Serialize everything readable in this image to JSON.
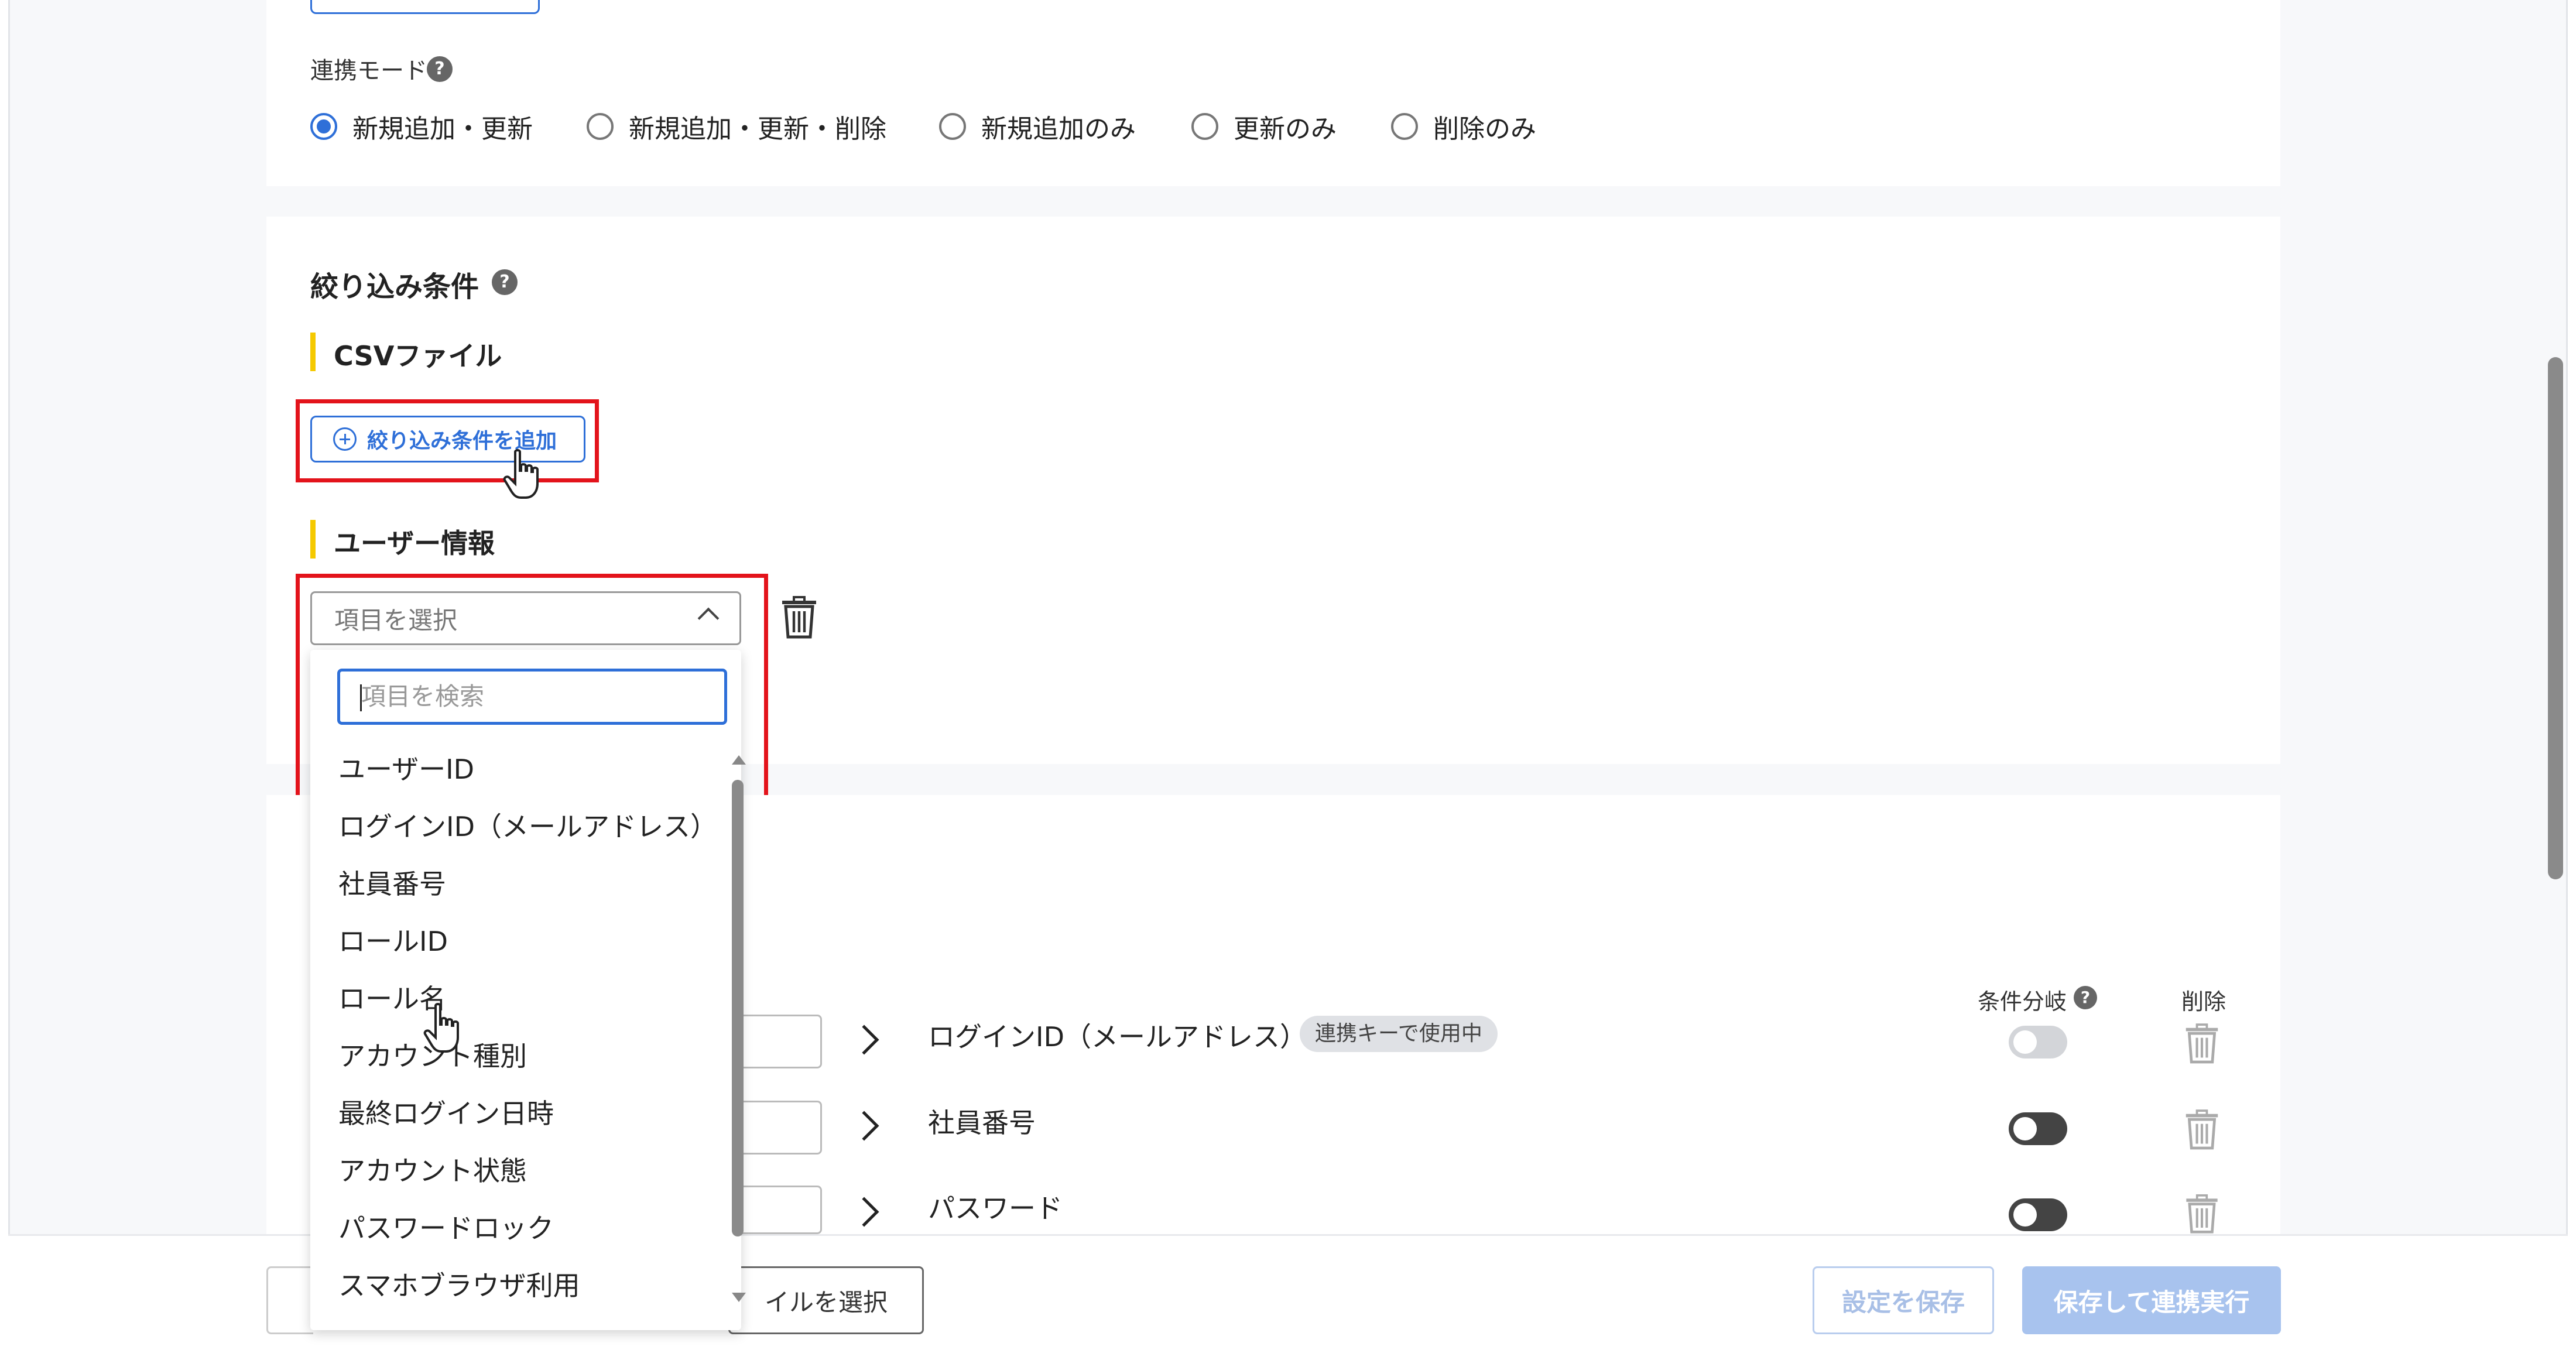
{
  "mode": {
    "label": "連携モード",
    "options": [
      "新規追加・更新",
      "新規追加・更新・削除",
      "新規追加のみ",
      "更新のみ",
      "削除のみ"
    ],
    "selected": "新規追加・更新"
  },
  "filter": {
    "title": "絞り込み条件",
    "csv_heading": "CSVファイル",
    "add_button": "絞り込み条件を追加",
    "user_heading": "ユーザー情報",
    "select_placeholder": "項目を選択",
    "search_placeholder": "項目を検索",
    "options": [
      "ユーザーID",
      "ログインID（メールアドレス）",
      "社員番号",
      "ロールID",
      "ロール名",
      "アカウント種別",
      "最終ログイン日時",
      "アカウント状態",
      "パスワードロック",
      "スマホブラウザ利用"
    ]
  },
  "mapping": {
    "columns": {
      "branch": "条件分岐",
      "delete": "削除"
    },
    "rows": [
      {
        "label": "ログインID（メールアドレス）",
        "badge": "連携キーで使用中",
        "toggle": "off"
      },
      {
        "label": "社員番号",
        "badge": "",
        "toggle": "on"
      },
      {
        "label": "パスワード",
        "badge": "",
        "toggle": "on"
      }
    ]
  },
  "footer": {
    "file_button": "ファイルを選択",
    "file_button_visible": "イルを選択",
    "save": "設定を保存",
    "save_run": "保存して連携実行"
  },
  "colors": {
    "accent": "#2e6fd8",
    "highlight": "#e3131b",
    "marker": "#f5c900"
  }
}
